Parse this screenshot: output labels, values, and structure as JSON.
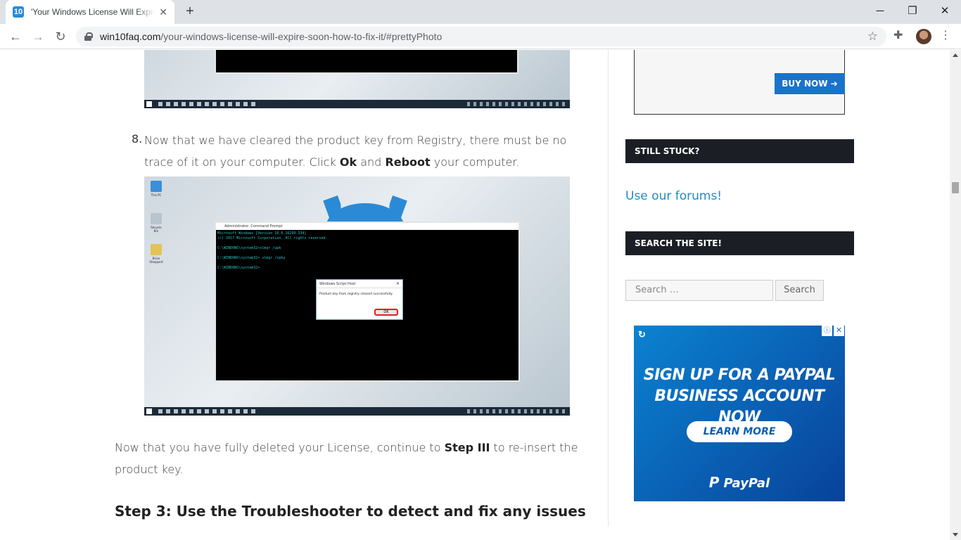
{
  "browser": {
    "tab_title": "'Your Windows License Will Expire Soon' How to Fix It",
    "tab_favicon": "10",
    "new_tab_label": "+",
    "url_host": "win10faq.com",
    "url_path": "/your-windows-license-will-expire-soon-how-to-fix-it/#prettyPhoto"
  },
  "article": {
    "step8_number": "8.",
    "step8_line1": "Now that we have cleared the product key from Registry, there must be no",
    "step8_line2_a": "trace of it on your computer. Click ",
    "step8_ok": "Ok",
    "step8_and": " and ",
    "step8_reboot": "Reboot",
    "step8_end": " your computer.",
    "para_a": "Now that you have fully deleted your License, continue to ",
    "para_step": "Step III",
    "para_b": " to re-insert the",
    "para_line2": "product key.",
    "heading_step3": "Step 3: Use the Troubleshooter to detect and fix any issues"
  },
  "screenshot2": {
    "cmd_title": "Administrator: Command Prompt",
    "cmd_lines": "Microsoft Windows [Version 10.0.16299.334]\n(c) 2017 Microsoft Corporation. All rights reserved.\n\nC:\\WINDOWS\\system32>slmgr /upk\n\nC:\\WINDOWS\\system32> slmgr /cpky\n\nC:\\WINDOWS\\system32>",
    "msgbox_title": "Windows Script Host",
    "msgbox_text": "Product key from registry cleared successfully.",
    "msgbox_ok": "OK",
    "desktop_icons": [
      "This PC",
      "Recycle Bin",
      "Brian Sheppard"
    ]
  },
  "sidebar": {
    "buy_now": "BUY NOW ➔",
    "still_stuck": "STILL STUCK?",
    "forum_link": "Use our forums!",
    "search_title": "SEARCH THE SITE!",
    "search_placeholder": "Search …",
    "search_button": "Search"
  },
  "paypal_ad": {
    "headline_1": "SIGN UP FOR A PAYPAL",
    "headline_2": "BUSINESS ACCOUNT NOW",
    "cta": "LEARN MORE",
    "logo": "PayPal"
  },
  "colors": {
    "link": "#1e8bc3",
    "widget_title_bg": "#1b1f25",
    "buy_now_bg": "#1a73c9",
    "paypal_blue": "#0a5fb3"
  }
}
